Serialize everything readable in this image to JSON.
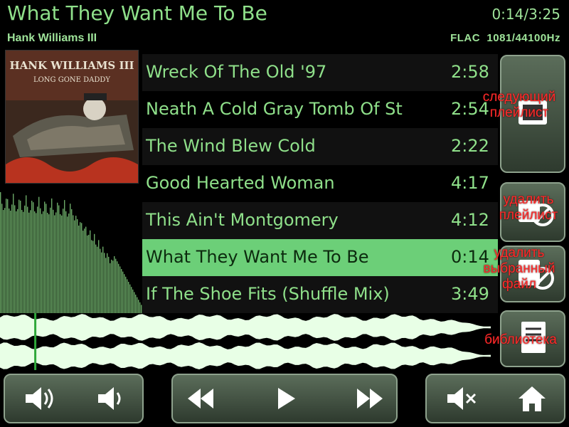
{
  "now_playing": {
    "title": "What They Want Me To Be",
    "time": "0:14/3:25",
    "artist": "Hank Williams III",
    "format": "FLAC  1081/44100Hz",
    "progress_fraction": 0.068
  },
  "album_cover": {
    "text_line1": "HANK WILLIAMS III",
    "text_line2": "LONG GONE DADDY"
  },
  "tracks": [
    {
      "title": "Wreck Of The Old '97",
      "duration": "2:58"
    },
    {
      "title": "Neath A Cold Gray Tomb Of St",
      "duration": "2:54"
    },
    {
      "title": "The Wind Blew Cold",
      "duration": "2:22"
    },
    {
      "title": "Good Hearted Woman",
      "duration": "4:17"
    },
    {
      "title": "This Ain't Montgomery",
      "duration": "4:12"
    },
    {
      "title": "What They Want Me To Be",
      "duration": "0:14"
    },
    {
      "title": "If The Shoe Fits (Shuffle Mix)",
      "duration": "3:49"
    }
  ],
  "selected_track_index": 5,
  "side_buttons": {
    "next_playlist": "следующий\nплейлист",
    "delete_playlist": "удалить\nплейлист",
    "delete_file": "удалить\nвыбранный\nфайл",
    "library": "библиотека"
  },
  "controls": {
    "volume_up": "volume-up-icon",
    "volume_down": "volume-down-icon",
    "rewind": "rewind-icon",
    "play": "play-icon",
    "fast_forward": "fast-forward-icon",
    "mute": "mute-icon",
    "home": "home-icon"
  },
  "colors": {
    "accent": "#8fe08a",
    "selected_row": "#6ccf78",
    "annotation": "#ff2a2a"
  }
}
